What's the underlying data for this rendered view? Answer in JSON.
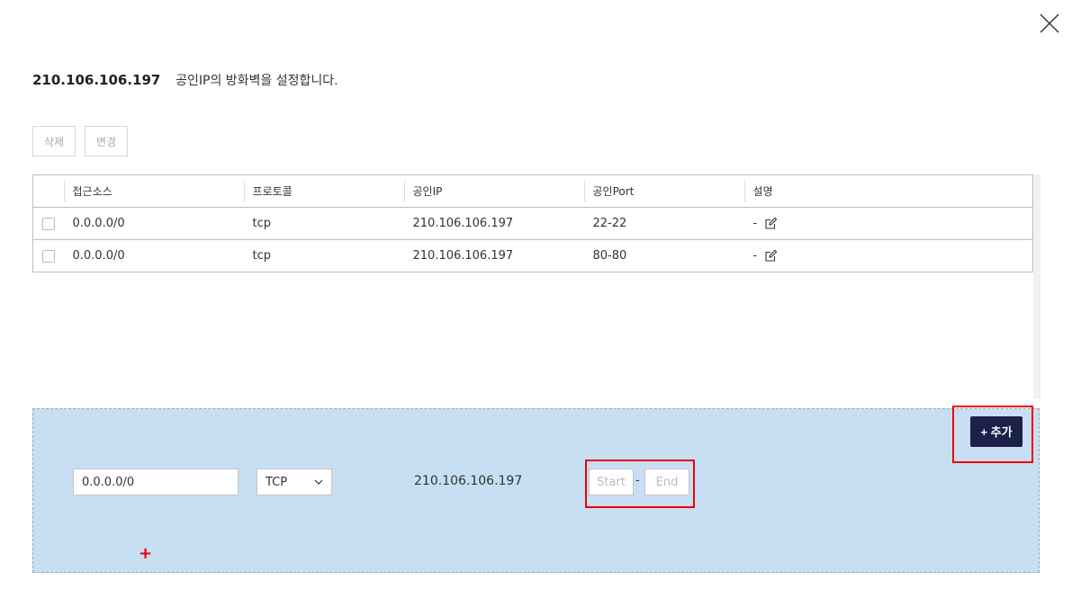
{
  "header": {
    "ip": "210.106.106.197",
    "description": "공인IP의 방화벽을 설정합니다."
  },
  "toolbar": {
    "delete_label": "삭제",
    "edit_label": "변경"
  },
  "table": {
    "columns": [
      "접근소스",
      "프로토콜",
      "공인IP",
      "공인Port",
      "설명"
    ],
    "rows": [
      {
        "source": "0.0.0.0/0",
        "protocol": "tcp",
        "public_ip": "210.106.106.197",
        "port": "22-22",
        "description": "-"
      },
      {
        "source": "0.0.0.0/0",
        "protocol": "tcp",
        "public_ip": "210.106.106.197",
        "port": "80-80",
        "description": "-"
      }
    ]
  },
  "add_form": {
    "source_value": "0.0.0.0/0",
    "protocol_selected": "TCP",
    "public_ip": "210.106.106.197",
    "port_start_placeholder": "Start",
    "port_end_placeholder": "End",
    "port_separator": "-",
    "add_button_label": "+ 추가",
    "marker": "+"
  },
  "colors": {
    "panel_bg": "#c8dff3",
    "add_button_bg": "#1b2149",
    "highlight": "#e00000"
  },
  "icons": [
    "close-icon",
    "edit-icon",
    "chevron-down-icon"
  ]
}
